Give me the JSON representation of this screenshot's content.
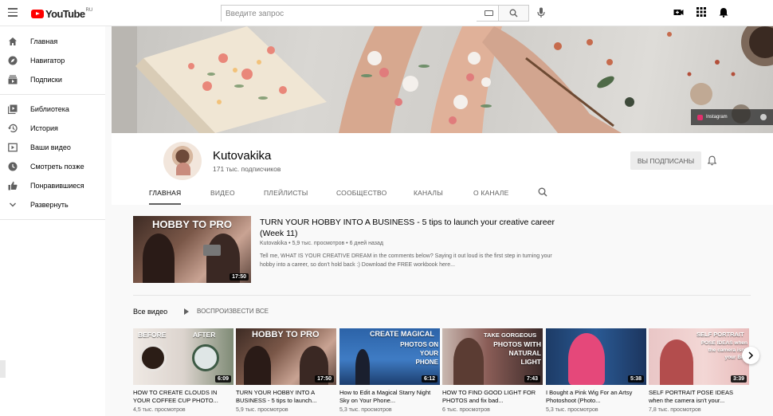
{
  "header": {
    "logo_text": "YouTube",
    "logo_region": "RU",
    "search_placeholder": "Введите запрос"
  },
  "sidebar": {
    "items": [
      {
        "label": "Главная",
        "icon": "home-icon"
      },
      {
        "label": "Навигатор",
        "icon": "compass-icon"
      },
      {
        "label": "Подписки",
        "icon": "subscriptions-icon"
      }
    ],
    "items2": [
      {
        "label": "Библиотека",
        "icon": "library-icon"
      },
      {
        "label": "История",
        "icon": "history-icon"
      },
      {
        "label": "Ваши видео",
        "icon": "your-videos-icon"
      },
      {
        "label": "Смотреть позже",
        "icon": "watch-later-icon"
      },
      {
        "label": "Понравившиеся",
        "icon": "thumbs-up-icon"
      },
      {
        "label": "Развернуть",
        "icon": "chevron-down-icon"
      }
    ]
  },
  "banner": {
    "instagram_label": "Instagram"
  },
  "channel": {
    "name": "Kutovakika",
    "subscribers": "171 тыс. подписчиков",
    "subscribed_label": "ВЫ ПОДПИСАНЫ",
    "tabs": [
      "ГЛАВНАЯ",
      "ВИДЕО",
      "ПЛЕЙЛИСТЫ",
      "СООБЩЕСТВО",
      "КАНАЛЫ",
      "О КАНАЛЕ"
    ]
  },
  "featured": {
    "thumb_text": "HOBBY TO PRO",
    "duration": "17:50",
    "title": "TURN YOUR HOBBY INTO A BUSINESS - 5 tips to launch your creative career (Week 11)",
    "meta": "Kutovakika • 5,9 тыс. просмотров • 6 дней назад",
    "description": "Tell me, WHAT IS YOUR CREATIVE DREAM in the comments below? Saying it out loud is the first step in turning your hobby into a career, so don't hold back :) Download the FREE workbook here..."
  },
  "section": {
    "title": "Все видео",
    "play_all": "ВОСПРОИЗВЕСТИ ВСЕ"
  },
  "videos": [
    {
      "thumb_text_1": "BEFORE",
      "thumb_text_2": "AFTER",
      "duration": "6:09",
      "title": "HOW TO CREATE CLOUDS IN YOUR COFFEE CUP PHOTO...",
      "meta": "4,5 тыс. просмотров"
    },
    {
      "thumb_text_1": "HOBBY TO PRO",
      "thumb_text_2": "",
      "duration": "17:50",
      "title": "TURN YOUR HOBBY INTO A BUSINESS - 5 tips to launch...",
      "meta": "5,9 тыс. просмотров"
    },
    {
      "thumb_text_1": "CREATE MAGICAL",
      "thumb_text_2": "PHOTOS ON YOUR PHONE",
      "duration": "6:12",
      "title": "How to Edit a Magical Starry Night Sky on Your Phone...",
      "meta": "5,3 тыс. просмотров"
    },
    {
      "thumb_text_1": "TAKE GORGEOUS",
      "thumb_text_2": "PHOTOS WITH NATURAL LIGHT",
      "duration": "7:43",
      "title": "HOW TO FIND GOOD LIGHT FOR PHOTOS and fix bad...",
      "meta": "6 тыс. просмотров"
    },
    {
      "thumb_text_1": "",
      "thumb_text_2": "",
      "duration": "5:38",
      "title": "I Bought a Pink Wig For an Artsy Photoshoot (Photo...",
      "meta": "5,3 тыс. просмотров"
    },
    {
      "thumb_text_1": "SELF PORTRAIT",
      "thumb_text_2": "POSE IDEAS when the camera isn't your BFF",
      "duration": "3:39",
      "title": "SELF PORTRAIT POSE IDEAS when the camera isn't your...",
      "meta": "7,8 тыс. просмотров"
    }
  ]
}
